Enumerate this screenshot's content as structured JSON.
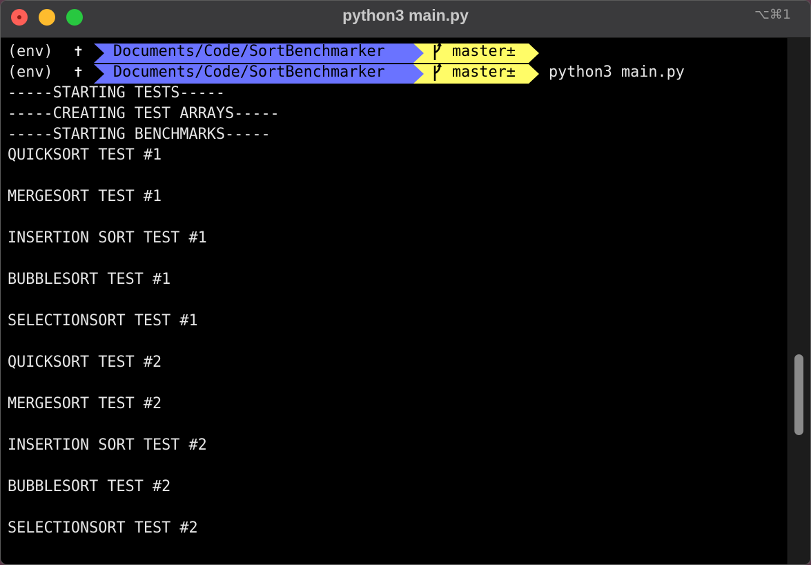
{
  "window": {
    "title": "python3 main.py",
    "shortcut": "⌥⌘1"
  },
  "prompts": [
    {
      "env": "(env)",
      "marker": "✝",
      "directory": "Documents/Code/SortBenchmarker",
      "branch": "master±",
      "command": ""
    },
    {
      "env": "(env)",
      "marker": "✝",
      "directory": "Documents/Code/SortBenchmarker",
      "branch": "master±",
      "command": "python3 main.py"
    }
  ],
  "output": [
    "-----STARTING TESTS-----",
    "-----CREATING TEST ARRAYS-----",
    "-----STARTING BENCHMARKS-----",
    "QUICKSORT TEST #1",
    "",
    "MERGESORT TEST #1",
    "",
    "INSERTION SORT TEST #1",
    "",
    "BUBBLESORT TEST #1",
    "",
    "SELECTIONSORT TEST #1",
    "",
    "QUICKSORT TEST #2",
    "",
    "MERGESORT TEST #2",
    "",
    "INSERTION SORT TEST #2",
    "",
    "BUBBLESORT TEST #2",
    "",
    "SELECTIONSORT TEST #2"
  ],
  "colors": {
    "directory_segment": "#6a73ff",
    "branch_segment": "#fffc67",
    "terminal_background": "#000000",
    "terminal_text": "#e6e6e6"
  }
}
